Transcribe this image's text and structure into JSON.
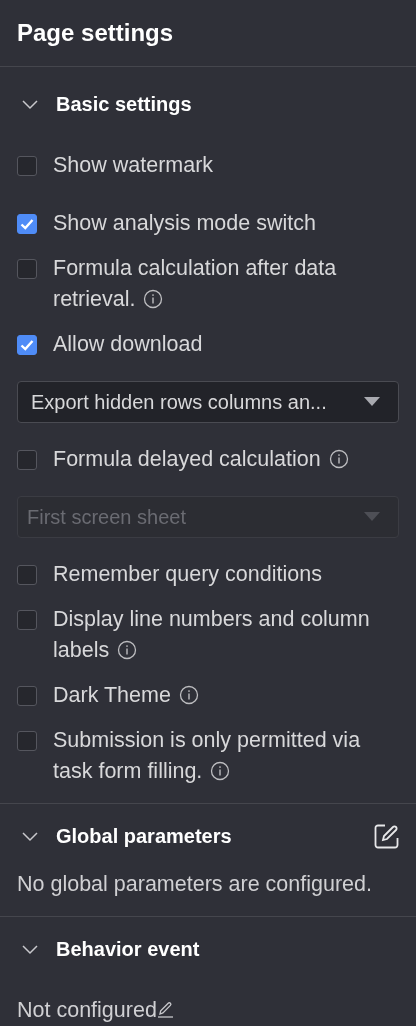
{
  "title": "Page settings",
  "sections": [
    {
      "title": "Basic settings",
      "expanded": true,
      "items": [
        {
          "kind": "checkbox",
          "label": "Show watermark",
          "checked": false,
          "info": false
        },
        {
          "kind": "checkbox",
          "label": "Show analysis mode switch",
          "checked": true,
          "info": false
        },
        {
          "kind": "checkbox",
          "label": "Formula calculation after data retrieval.",
          "checked": false,
          "info": true
        },
        {
          "kind": "checkbox",
          "label": "Allow download",
          "checked": true,
          "info": false
        },
        {
          "kind": "select",
          "value": "Export hidden rows columns an...",
          "disabled": false
        },
        {
          "kind": "checkbox",
          "label": "Formula delayed calculation",
          "checked": false,
          "info": true
        },
        {
          "kind": "select",
          "placeholder": "First screen sheet",
          "disabled": true
        },
        {
          "kind": "checkbox",
          "label": "Remember query conditions",
          "checked": false,
          "info": false
        },
        {
          "kind": "checkbox",
          "label": "Display line numbers and column labels",
          "checked": false,
          "info": true
        },
        {
          "kind": "checkbox",
          "label": "Dark Theme",
          "checked": false,
          "info": true
        },
        {
          "kind": "checkbox",
          "label": "Submission is only permitted via task form filling.",
          "checked": false,
          "info": true
        }
      ]
    },
    {
      "title": "Global parameters",
      "expanded": true,
      "edit_button": true,
      "note": "No global parameters are configured.",
      "note_edit": false
    },
    {
      "title": "Behavior event",
      "expanded": true,
      "edit_button": false,
      "note": "Not configured",
      "note_edit": true
    }
  ]
}
